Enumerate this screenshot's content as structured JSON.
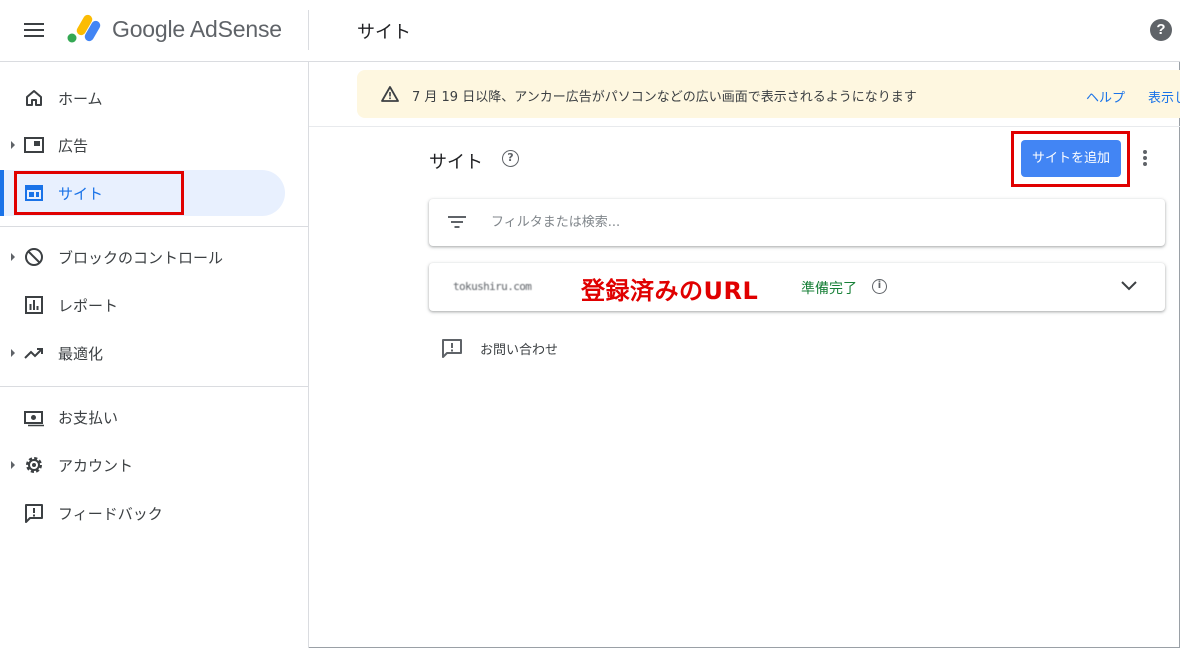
{
  "header": {
    "brand": "Google AdSense",
    "page_title": "サイト",
    "help": "?"
  },
  "sidebar": {
    "items": [
      {
        "label": "ホーム",
        "icon": "home-icon"
      },
      {
        "label": "広告",
        "icon": "ads-icon"
      },
      {
        "label": "サイト",
        "icon": "sites-icon"
      },
      {
        "label": "ブロックのコントロール",
        "icon": "block-icon"
      },
      {
        "label": "レポート",
        "icon": "report-icon"
      },
      {
        "label": "最適化",
        "icon": "optimize-icon"
      },
      {
        "label": "お支払い",
        "icon": "payments-icon"
      },
      {
        "label": "アカウント",
        "icon": "gear-icon"
      },
      {
        "label": "フィードバック",
        "icon": "feedback-icon"
      }
    ],
    "active_item": "サイト"
  },
  "banner": {
    "text": "7 月 19 日以降、アンカー広告がパソコンなどの広い画面で表示されるようになります",
    "help_link": "ヘルプ",
    "show_link": "表示し"
  },
  "main": {
    "section_title": "サイト",
    "section_help": "?",
    "add_site_button": "サイトを追加",
    "filter_placeholder": "フィルタまたは検索...",
    "site": {
      "url": "tokushiru.com",
      "annotation": "登録済みのURL",
      "status": "準備完了",
      "info": "i"
    },
    "contact_label": "お問い合わせ"
  },
  "colors": {
    "accent": "#1a73e8",
    "button": "#4285f4",
    "banner_bg": "#fef7e0",
    "status_green": "#188038",
    "highlight_red": "#e00000",
    "active_bg": "#e8f0fe"
  }
}
